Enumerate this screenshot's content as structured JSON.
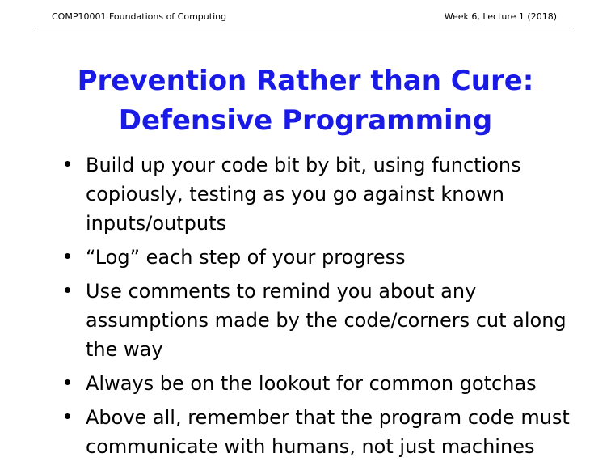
{
  "header": {
    "course": "COMP10001 Foundations of Computing",
    "week": "Week 6, Lecture 1 (2018)"
  },
  "title": {
    "line1": "Prevention Rather than Cure:",
    "line2": "Defensive Programming"
  },
  "bullets": [
    {
      "lines": [
        "Build up your code bit by bit, using functions",
        "copiously, testing as you go against known",
        "inputs/outputs"
      ]
    },
    {
      "lines": [
        "“Log” each step of your progress"
      ]
    },
    {
      "lines": [
        "Use comments to remind you about any",
        "assumptions made by the code/corners cut along",
        "the way"
      ]
    },
    {
      "lines": [
        "Always be on the lookout for common gotchas"
      ]
    },
    {
      "lines": [
        "Above all, remember that the program code must",
        "communicate with humans, not just machines"
      ]
    }
  ]
}
